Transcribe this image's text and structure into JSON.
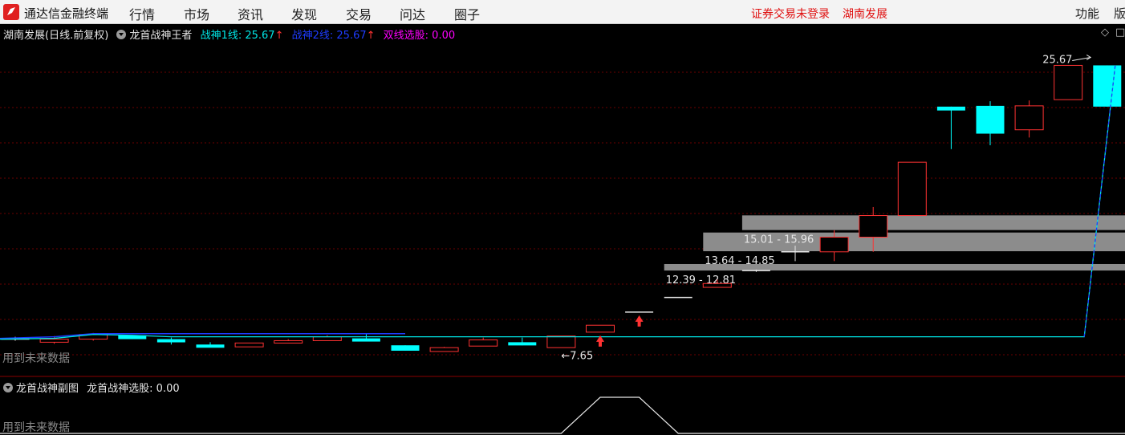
{
  "app": {
    "title": "通达信金融终端"
  },
  "menu": [
    "行情",
    "市场",
    "资讯",
    "发现",
    "交易",
    "问达",
    "圈子"
  ],
  "status": {
    "login": "证券交易未登录",
    "stock": "湖南发展"
  },
  "right_menu": {
    "func": "功能",
    "edition": "版"
  },
  "main_header": {
    "stock_label": "湖南发展(日线.前复权)",
    "indicator": "龙首战神王者",
    "line1": "战神1线: 25.67",
    "line2": "战神2线: 25.67",
    "dual": "双线选股: 0.00",
    "diamond": "◇",
    "square": "□"
  },
  "sub_header": {
    "title": "龙首战神副图",
    "value": "龙首战神选股: 0.00"
  },
  "future_label": "用到未来数据",
  "colors": {
    "up": "#ff3232",
    "down": "#00ffff",
    "line1": "#00e5e5",
    "line2": "#1e3cff",
    "dual": "#ff00ff",
    "grid": "#6a0000",
    "zone": "#8c8c8c"
  },
  "chart_data": {
    "type": "candlestick",
    "price_range": [
      5.9,
      27.2
    ],
    "candles": [
      {
        "o": 7.95,
        "h": 8.1,
        "l": 7.85,
        "c": 7.95
      },
      {
        "o": 7.75,
        "h": 8.15,
        "l": 7.65,
        "c": 7.95
      },
      {
        "o": 7.95,
        "h": 8.35,
        "l": 7.85,
        "c": 8.25
      },
      {
        "o": 8.2,
        "h": 8.2,
        "l": 7.95,
        "c": 7.95
      },
      {
        "o": 7.95,
        "h": 8.05,
        "l": 7.6,
        "c": 7.75
      },
      {
        "o": 7.6,
        "h": 7.75,
        "l": 7.45,
        "c": 7.55
      },
      {
        "o": 7.45,
        "h": 7.7,
        "l": 7.45,
        "c": 7.7
      },
      {
        "o": 7.7,
        "h": 7.95,
        "l": 7.7,
        "c": 7.85
      },
      {
        "o": 7.85,
        "h": 8.2,
        "l": 7.85,
        "c": 8.1
      },
      {
        "o": 8.0,
        "h": 8.3,
        "l": 7.95,
        "c": 7.95
      },
      {
        "o": 7.55,
        "h": 7.55,
        "l": 7.2,
        "c": 7.2
      },
      {
        "o": 7.15,
        "h": 7.45,
        "l": 7.15,
        "c": 7.4
      },
      {
        "o": 7.5,
        "h": 8.05,
        "l": 7.5,
        "c": 7.9
      },
      {
        "o": 7.75,
        "h": 8.05,
        "l": 7.55,
        "c": 7.55
      },
      {
        "o": 7.4,
        "h": 8.15,
        "l": 7.4,
        "c": 8.15
      },
      {
        "o": 8.4,
        "h": 8.85,
        "l": 8.4,
        "c": 8.85
      },
      {
        "o": 9.7,
        "h": 9.7,
        "l": 9.7,
        "c": 9.7
      },
      {
        "o": 10.65,
        "h": 10.65,
        "l": 10.65,
        "c": 10.65
      },
      {
        "o": 11.3,
        "h": 11.8,
        "l": 11.3,
        "c": 11.55
      },
      {
        "o": 12.39,
        "h": 12.45,
        "l": 12.3,
        "c": 12.39
      },
      {
        "o": 13.6,
        "h": 14.0,
        "l": 13.0,
        "c": 13.6
      },
      {
        "o": 13.6,
        "h": 15.0,
        "l": 13.0,
        "c": 14.55
      },
      {
        "o": 14.55,
        "h": 16.5,
        "l": 13.6,
        "c": 15.95
      },
      {
        "o": 15.95,
        "h": 19.4,
        "l": 16.5,
        "c": 19.4
      },
      {
        "o": 23.0,
        "h": 23.0,
        "l": 20.25,
        "c": 22.75
      },
      {
        "o": 23.05,
        "h": 23.35,
        "l": 20.5,
        "c": 21.25
      },
      {
        "o": 21.5,
        "h": 23.4,
        "l": 21.0,
        "c": 23.05
      },
      {
        "o": 23.45,
        "h": 25.67,
        "l": 23.45,
        "c": 25.67
      },
      {
        "o": 25.67,
        "h": 25.67,
        "l": 23.0,
        "c": 23.0
      }
    ],
    "line1": [
      7.95,
      8.0,
      8.25,
      8.2,
      8.1,
      8.1,
      8.1,
      8.1,
      8.1,
      8.1,
      8.1,
      8.1,
      8.1,
      8.1,
      8.1,
      8.1,
      8.1,
      8.1,
      8.1,
      8.1,
      8.1,
      8.1,
      8.1,
      8.1,
      8.1,
      8.1,
      8.1,
      8.1,
      25.67
    ],
    "line2": [
      8.0,
      8.1,
      8.3,
      8.3,
      8.3,
      8.3,
      8.3,
      8.3,
      8.3,
      8.3,
      8.3
    ],
    "signal_arrows": [
      15,
      16
    ],
    "zones": [
      {
        "start": 17,
        "low": 12.39,
        "high": 12.81,
        "label": "12.39 - 12.81"
      },
      {
        "start": 18,
        "low": 13.64,
        "high": 14.85,
        "label": "13.64 - 14.85"
      },
      {
        "start": 19,
        "low": 15.01,
        "high": 15.96,
        "label": "15.01 - 15.96"
      }
    ],
    "annotations": [
      {
        "index": 14,
        "price": 7.65,
        "label": "7.65",
        "side": "left"
      },
      {
        "index": 27,
        "price": 25.67,
        "label": "25.67",
        "side": "right"
      }
    ],
    "sub_signal": [
      0,
      0,
      0,
      0,
      0,
      0,
      0,
      0,
      0,
      0,
      0,
      0,
      0,
      0,
      0,
      1,
      1,
      0,
      0,
      0,
      0,
      0,
      0,
      0,
      0,
      0,
      0,
      0,
      0
    ]
  }
}
